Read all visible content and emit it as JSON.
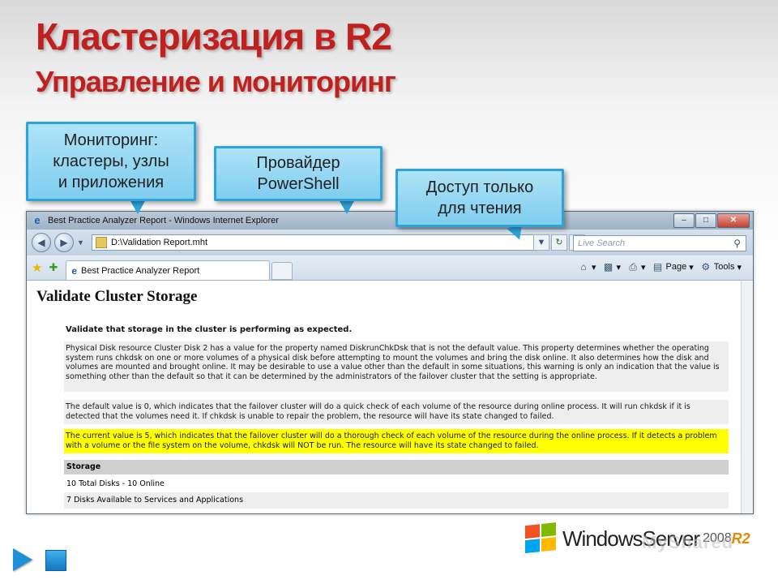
{
  "slide": {
    "title": "Кластеризация в R2",
    "subtitle": "Управление и мониторинг"
  },
  "callouts": [
    {
      "text": "Мониторинг:\nкластеры, узлы\nи приложения"
    },
    {
      "text": "Провайдер\nPowerShell"
    },
    {
      "text": "Доступ только\nдля чтения"
    }
  ],
  "browser": {
    "window_title": "Best Practice Analyzer Report - Windows Internet Explorer",
    "address": "D:\\Validation Report.mht",
    "search_placeholder": "Live Search",
    "tab_label": "Best Practice Analyzer Report",
    "page_menu": "Page",
    "tools_menu": "Tools"
  },
  "report": {
    "heading": "Validate Cluster Storage",
    "intro": "Validate that storage in the cluster is performing as expected.",
    "paragraphs": [
      "Physical Disk resource Cluster Disk 2 has a value for the property named DiskrunChkDsk that is not the default value. This property determines whether the operating system runs chkdsk on one or more volumes of a physical disk before attempting to mount the volumes and bring the disk online. It also determines how the disk and volumes are mounted and brought online. It may be desirable to use a value other than the default in some situations, this warning is only an indication that the value is something other than the default so that it can be determined by the administrators of the failover cluster that the setting is appropriate.",
      "The default value is 0, which indicates that the failover cluster will do a quick check of each volume of the resource during online process. It will run chkdsk if it is detected that the volumes need it. If chkdsk is unable to repair the problem, the resource will have its state changed to failed.",
      "The current value is 5, which indicates that the failover cluster will do a thorough check of each volume of the resource during the online process. If it detects a problem with a volume or the file system on the volume, chkdsk will NOT be run. The resource will have its state changed to failed."
    ],
    "table_header": "Storage",
    "table_rows": [
      "10 Total Disks - 10 Online",
      "7 Disks Available to Services and Applications"
    ]
  },
  "branding": {
    "windows": "Windows",
    "server": "Server",
    "version": "2008",
    "release": "R2",
    "watermark": "MyShared"
  },
  "colors": {
    "title": "#c0201e",
    "callout_fill": "#8fd4f2",
    "callout_border": "#2ea3d8",
    "highlight": "#ffff00"
  }
}
